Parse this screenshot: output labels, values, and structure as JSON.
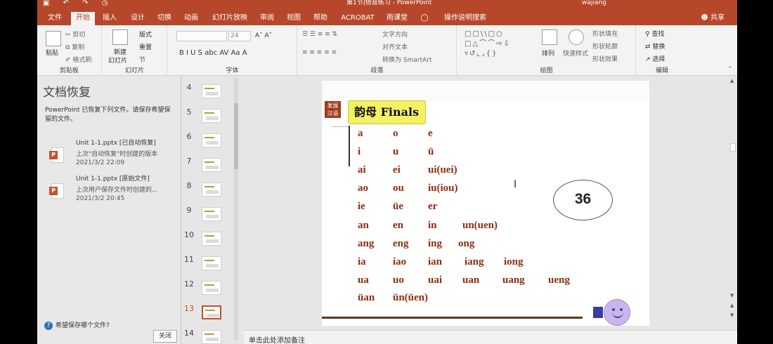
{
  "titlebar": {
    "qat": "▣ ↶ ↷ ◷",
    "title": "第1节|借音练习 - PowerPoint",
    "user": "wajiang"
  },
  "tabs": [
    "文件",
    "开始",
    "插入",
    "设计",
    "切换",
    "动画",
    "幻灯片放映",
    "审阅",
    "视图",
    "帮助",
    "ACROBAT",
    "雨课堂",
    "操作说明搜索"
  ],
  "share": "共享",
  "ribbon": {
    "clipboard": {
      "paste": "粘贴",
      "cut": "剪切",
      "copy": "复制",
      "format": "格式刷",
      "label": "剪贴板"
    },
    "slides": {
      "new": "新建",
      "new2": "幻灯片",
      "layout": "版式",
      "reset": "重置",
      "section": "节",
      "label": "幻灯片"
    },
    "font": {
      "size": "24",
      "label": "字体",
      "formats": "B  I  U  S  abc  AV  Aa  A"
    },
    "paragraph": {
      "text_direction": "文字方向",
      "align_text": "对齐文本",
      "smartart": "转换为 SmartArt",
      "label": "段落"
    },
    "drawing": {
      "arrange": "排列",
      "quick_styles": "快速样式",
      "fill": "形状填充",
      "outline": "形状轮廓",
      "effects": "形状效果",
      "label": "绘图"
    },
    "editing": {
      "find": "查找",
      "replace": "替换",
      "select": "选择",
      "label": "编辑"
    }
  },
  "recovery": {
    "title": "文档恢复",
    "message": "PowerPoint 已恢复下列文件。请保存希望保留的文件。",
    "files": [
      {
        "name": "Unit 1-1.pptx  [已自动恢复]",
        "desc": "上次\"自动恢复\"时创建的版本",
        "date": "2021/3/2 22:09"
      },
      {
        "name": "Unit 1-1.pptx  [原始文件]",
        "desc": "上次用户保存文件时创建的...",
        "date": "2021/3/2 20:45"
      }
    ],
    "help": "希望保存哪个文件?",
    "close": "关闭"
  },
  "thumbnails": [
    "4",
    "5",
    "6",
    "7",
    "8",
    "9",
    "10",
    "11",
    "12",
    "13",
    "14"
  ],
  "selected_slide": "13",
  "slide": {
    "badge": "发展汉语",
    "title": "韵母 Finals",
    "rows": [
      [
        "a",
        "o",
        "e"
      ],
      [
        "i",
        "u",
        "ü"
      ],
      [
        "ai",
        "ei",
        "ui(uei)"
      ],
      [
        "ao",
        "ou",
        "iu(iou)"
      ],
      [
        "ie",
        "üe",
        "er"
      ],
      [
        "an",
        "en",
        "in",
        "un(uen)"
      ],
      [
        "ang",
        "eng",
        "ing",
        "ong"
      ],
      [
        "ia",
        "iao",
        "ian",
        "iang",
        "iong"
      ],
      [
        "ua",
        "uo",
        "uai",
        "uan",
        "uang",
        "ueng"
      ],
      [
        "üan",
        "ün(üen)"
      ]
    ],
    "number": "36"
  },
  "notes_placeholder": "单击此处添加备注"
}
